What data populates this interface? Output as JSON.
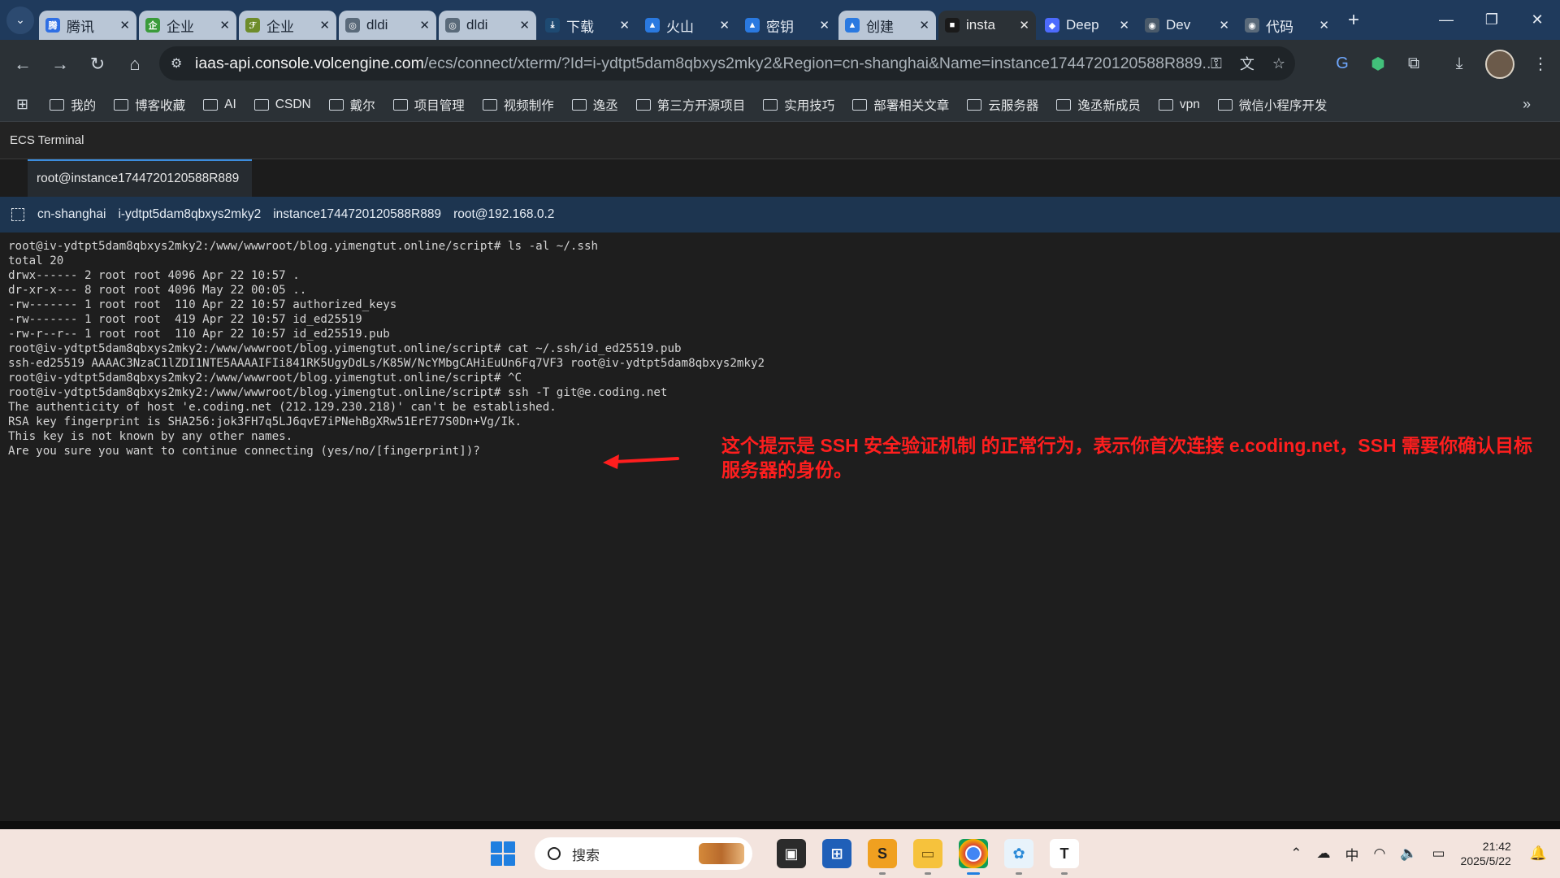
{
  "browser": {
    "tabs": [
      {
        "title": "腾讯",
        "color": "#2f6fe4",
        "glyph": "腾",
        "style": "light"
      },
      {
        "title": "企业",
        "color": "#3a9b3a",
        "glyph": "企",
        "style": "light"
      },
      {
        "title": "企业",
        "color": "#6e8c2a",
        "glyph": "ℱ",
        "style": "light"
      },
      {
        "title": "dldi",
        "color": "#5a6a7a",
        "glyph": "◎",
        "style": "light"
      },
      {
        "title": "dldi",
        "color": "#5a6a7a",
        "glyph": "◎",
        "style": "light"
      },
      {
        "title": "下载",
        "color": "#1e4a72",
        "glyph": "⤓",
        "style": "dark"
      },
      {
        "title": "火山",
        "color": "#2a79e0",
        "glyph": "▲",
        "style": "dark"
      },
      {
        "title": "密钥",
        "color": "#2a79e0",
        "glyph": "▲",
        "style": "dark"
      },
      {
        "title": "创建",
        "color": "#2a79e0",
        "glyph": "▲",
        "style": "light"
      },
      {
        "title": "insta",
        "color": "#1a1a1a",
        "glyph": "■",
        "style": "active"
      },
      {
        "title": "Deep",
        "color": "#4d6bfe",
        "glyph": "◆",
        "style": "dark"
      },
      {
        "title": "Dev",
        "color": "#4a5a6a",
        "glyph": "◉",
        "style": "dark"
      },
      {
        "title": "代码",
        "color": "#5a6a7a",
        "glyph": "◉",
        "style": "dark"
      }
    ],
    "url_host": "iaas-api.console.volcengine.com",
    "url_path": "/ecs/connect/xterm/?Id=i-ydtpt5dam8qbxys2mky2&Region=cn-shanghai&Name=instance1744720120588R889...",
    "bookmarks": [
      "我的",
      "博客收藏",
      "AI",
      "CSDN",
      "戴尔",
      "项目管理",
      "视频制作",
      "逸丞",
      "第三方开源项目",
      "实用技巧",
      "部署相关文章",
      "云服务器",
      "逸丞新成员",
      "vpn",
      "微信小程序开发"
    ]
  },
  "ecs": {
    "title": "ECS Terminal",
    "session_tab": "root@instance1744720120588R889",
    "info": [
      "cn-shanghai",
      "i-ydtpt5dam8qbxys2mky2",
      "instance1744720120588R889",
      "root@192.168.0.2"
    ]
  },
  "terminal": {
    "lines": [
      "root@iv-ydtpt5dam8qbxys2mky2:/www/wwwroot/blog.yimengtut.online/script# ls -al ~/.ssh",
      "total 20",
      "drwx------ 2 root root 4096 Apr 22 10:57 .",
      "dr-xr-x--- 8 root root 4096 May 22 00:05 ..",
      "-rw------- 1 root root  110 Apr 22 10:57 authorized_keys",
      "-rw------- 1 root root  419 Apr 22 10:57 id_ed25519",
      "-rw-r--r-- 1 root root  110 Apr 22 10:57 id_ed25519.pub",
      "root@iv-ydtpt5dam8qbxys2mky2:/www/wwwroot/blog.yimengtut.online/script# cat ~/.ssh/id_ed25519.pub",
      "ssh-ed25519 AAAAC3NzaC1lZDI1NTE5AAAAIFIi841RK5UgyDdLs/K85W/NcYMbgCAHiEuUn6Fq7VF3 root@iv-ydtpt5dam8qbxys2mky2",
      "root@iv-ydtpt5dam8qbxys2mky2:/www/wwwroot/blog.yimengtut.online/script# ^C",
      "root@iv-ydtpt5dam8qbxys2mky2:/www/wwwroot/blog.yimengtut.online/script# ssh -T git@e.coding.net",
      "The authenticity of host 'e.coding.net (212.129.230.218)' can't be established.",
      "RSA key fingerprint is SHA256:jok3FH7q5LJ6qvE7iPNehBgXRw51ErE77S0Dn+Vg/Ik.",
      "This key is not known by any other names.",
      "Are you sure you want to continue connecting (yes/no/[fingerprint])?"
    ],
    "annotation": "这个提示是 SSH 安全验证机制 的正常行为，表示你首次连接 e.coding.net，SSH 需要你确认目标服务器的身份。",
    "annotation_color": "#ff1e1e"
  },
  "taskbar": {
    "search_placeholder": "搜索",
    "time": "21:42",
    "date": "2025/5/22",
    "ime": "中"
  }
}
